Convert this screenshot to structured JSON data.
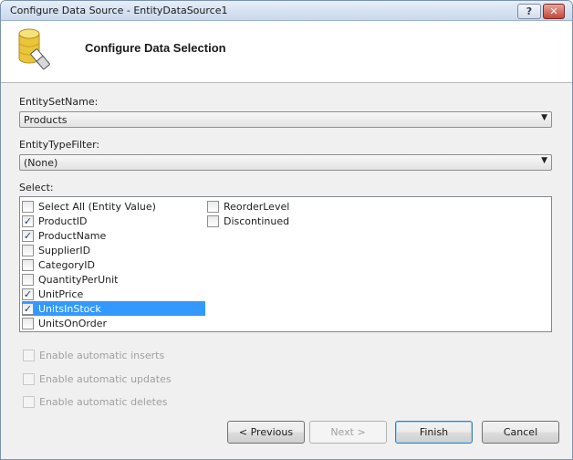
{
  "window": {
    "title": "Configure Data Source - EntityDataSource1",
    "help_label": "?",
    "close_label": "✕"
  },
  "header": {
    "icon": "database-icon",
    "title": "Configure Data Selection"
  },
  "entity_set": {
    "label": "EntitySetName:",
    "value": "Products"
  },
  "entity_type": {
    "label": "EntityTypeFilter:",
    "value": "(None)"
  },
  "select": {
    "label": "Select:",
    "items": [
      {
        "label": "Select All (Entity Value)",
        "checked": false,
        "check": ""
      },
      {
        "label": "ProductID",
        "checked": true,
        "check": "✓"
      },
      {
        "label": "ProductName",
        "checked": true,
        "check": "✓"
      },
      {
        "label": "SupplierID",
        "checked": false,
        "check": ""
      },
      {
        "label": "CategoryID",
        "checked": false,
        "check": ""
      },
      {
        "label": "QuantityPerUnit",
        "checked": false,
        "check": ""
      },
      {
        "label": "UnitPrice",
        "checked": true,
        "check": "✓"
      },
      {
        "label": "UnitsInStock",
        "checked": true,
        "check": "✓",
        "selected": true
      },
      {
        "label": "UnitsOnOrder",
        "checked": false,
        "check": ""
      },
      {
        "label": "ReorderLevel",
        "checked": false,
        "check": ""
      },
      {
        "label": "Discontinued",
        "checked": false,
        "check": ""
      }
    ]
  },
  "options": [
    {
      "label": "Enable automatic inserts",
      "enabled": false
    },
    {
      "label": "Enable automatic updates",
      "enabled": false
    },
    {
      "label": "Enable automatic deletes",
      "enabled": false
    }
  ],
  "buttons": {
    "previous": "< Previous",
    "next": "Next >",
    "finish": "Finish",
    "cancel": "Cancel"
  },
  "colors": {
    "selection": "#3399ff",
    "accent": "#3c7fb1"
  }
}
